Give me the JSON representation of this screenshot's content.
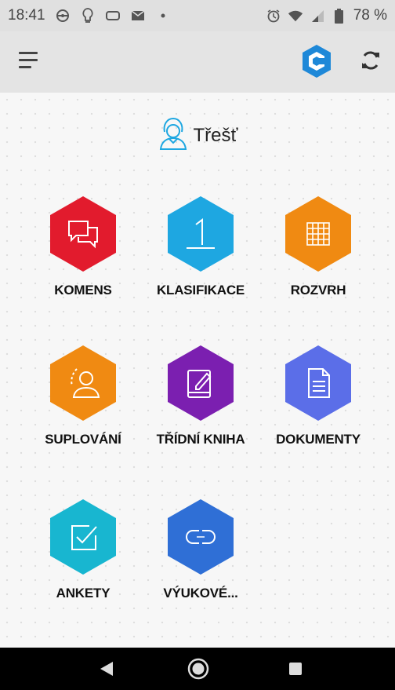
{
  "status_bar": {
    "time": "18:41",
    "battery": "78 %",
    "left_icons": [
      "vpn-icon",
      "bulb-icon",
      "cast-icon",
      "mail-icon",
      "dot-icon"
    ],
    "right_icons": [
      "alarm-icon",
      "wifi-icon",
      "signal-icon",
      "battery-icon"
    ]
  },
  "app_bar": {
    "menu_icon": "hamburger-menu-icon",
    "brand_icon": "bakalari-logo-icon",
    "refresh_icon": "refresh-icon",
    "brand_color": "#1e88d8"
  },
  "user": {
    "name": "Třešť",
    "icon": "user-avatar-icon"
  },
  "tiles": [
    {
      "label": "KOMENS",
      "color": "#e21b2d",
      "icon": "chat-bubbles-icon"
    },
    {
      "label": "KLASIFIKACE",
      "color": "#1ea7e1",
      "icon": "grade-one-icon"
    },
    {
      "label": "ROZVRH",
      "color": "#f08a12",
      "icon": "timetable-icon"
    },
    {
      "label": "SUPLOVÁNÍ",
      "color": "#f08a12",
      "icon": "substitute-person-icon"
    },
    {
      "label": "TŘÍDNÍ KNIHA",
      "color": "#7b1fb0",
      "icon": "class-book-icon"
    },
    {
      "label": "DOKUMENTY",
      "color": "#5b6ee8",
      "icon": "document-icon"
    },
    {
      "label": "ANKETY",
      "color": "#18b6d0",
      "icon": "checkbox-icon"
    },
    {
      "label": "VÝUKOVÉ...",
      "color": "#2f6fd6",
      "icon": "link-icon"
    }
  ],
  "nav_bar": {
    "back_icon": "back-triangle-icon",
    "home_icon": "home-circle-icon",
    "recents_icon": "recents-square-icon"
  }
}
